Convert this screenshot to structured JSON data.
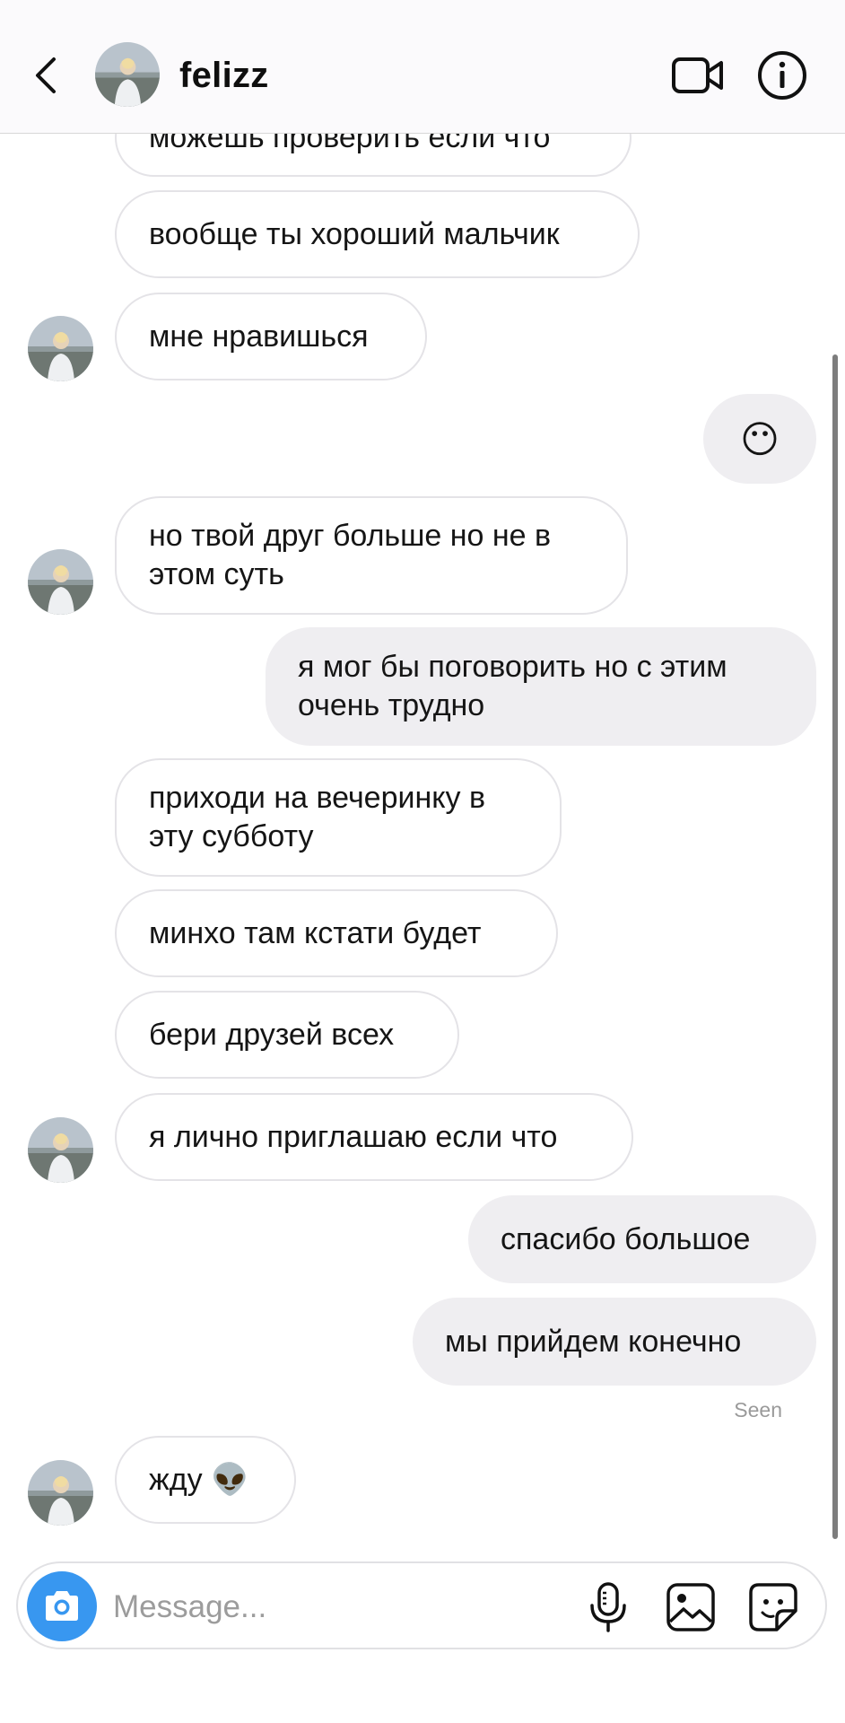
{
  "header": {
    "username": "felizz",
    "icons": {
      "back": "chevron-left-icon",
      "video": "video-camera-icon",
      "info": "info-circle-icon"
    }
  },
  "messages": [
    {
      "id": 1,
      "direction": "in",
      "text": "можешь проверить если что"
    },
    {
      "id": 2,
      "direction": "in",
      "text": "вообще ты хороший мальчик"
    },
    {
      "id": 3,
      "direction": "in",
      "text": "мне нравишься"
    },
    {
      "id": 4,
      "direction": "out",
      "text": "😶"
    },
    {
      "id": 5,
      "direction": "in",
      "text": "но твой друг больше но не в этом суть"
    },
    {
      "id": 6,
      "direction": "out",
      "text": "я мог бы поговорить но с этим очень трудно"
    },
    {
      "id": 7,
      "direction": "in",
      "text": "приходи на вечеринку в эту субботу"
    },
    {
      "id": 8,
      "direction": "in",
      "text": "минхо там кстати будет"
    },
    {
      "id": 9,
      "direction": "in",
      "text": "бери друзей всех"
    },
    {
      "id": 10,
      "direction": "in",
      "text": "я лично приглашаю если что"
    },
    {
      "id": 11,
      "direction": "out",
      "text": "спасибо большое"
    },
    {
      "id": 12,
      "direction": "out",
      "text": "мы прийдем конечно"
    },
    {
      "id": 13,
      "direction": "in",
      "text": "жду 👽"
    }
  ],
  "seen_label": "Seen",
  "composer": {
    "placeholder": "Message...",
    "icons": [
      "camera-icon",
      "microphone-icon",
      "gallery-icon",
      "sticker-icon"
    ]
  },
  "colors": {
    "accent": "#3897f0",
    "outgoing_bubble": "#efeef1",
    "incoming_border": "#e4e3e7"
  }
}
